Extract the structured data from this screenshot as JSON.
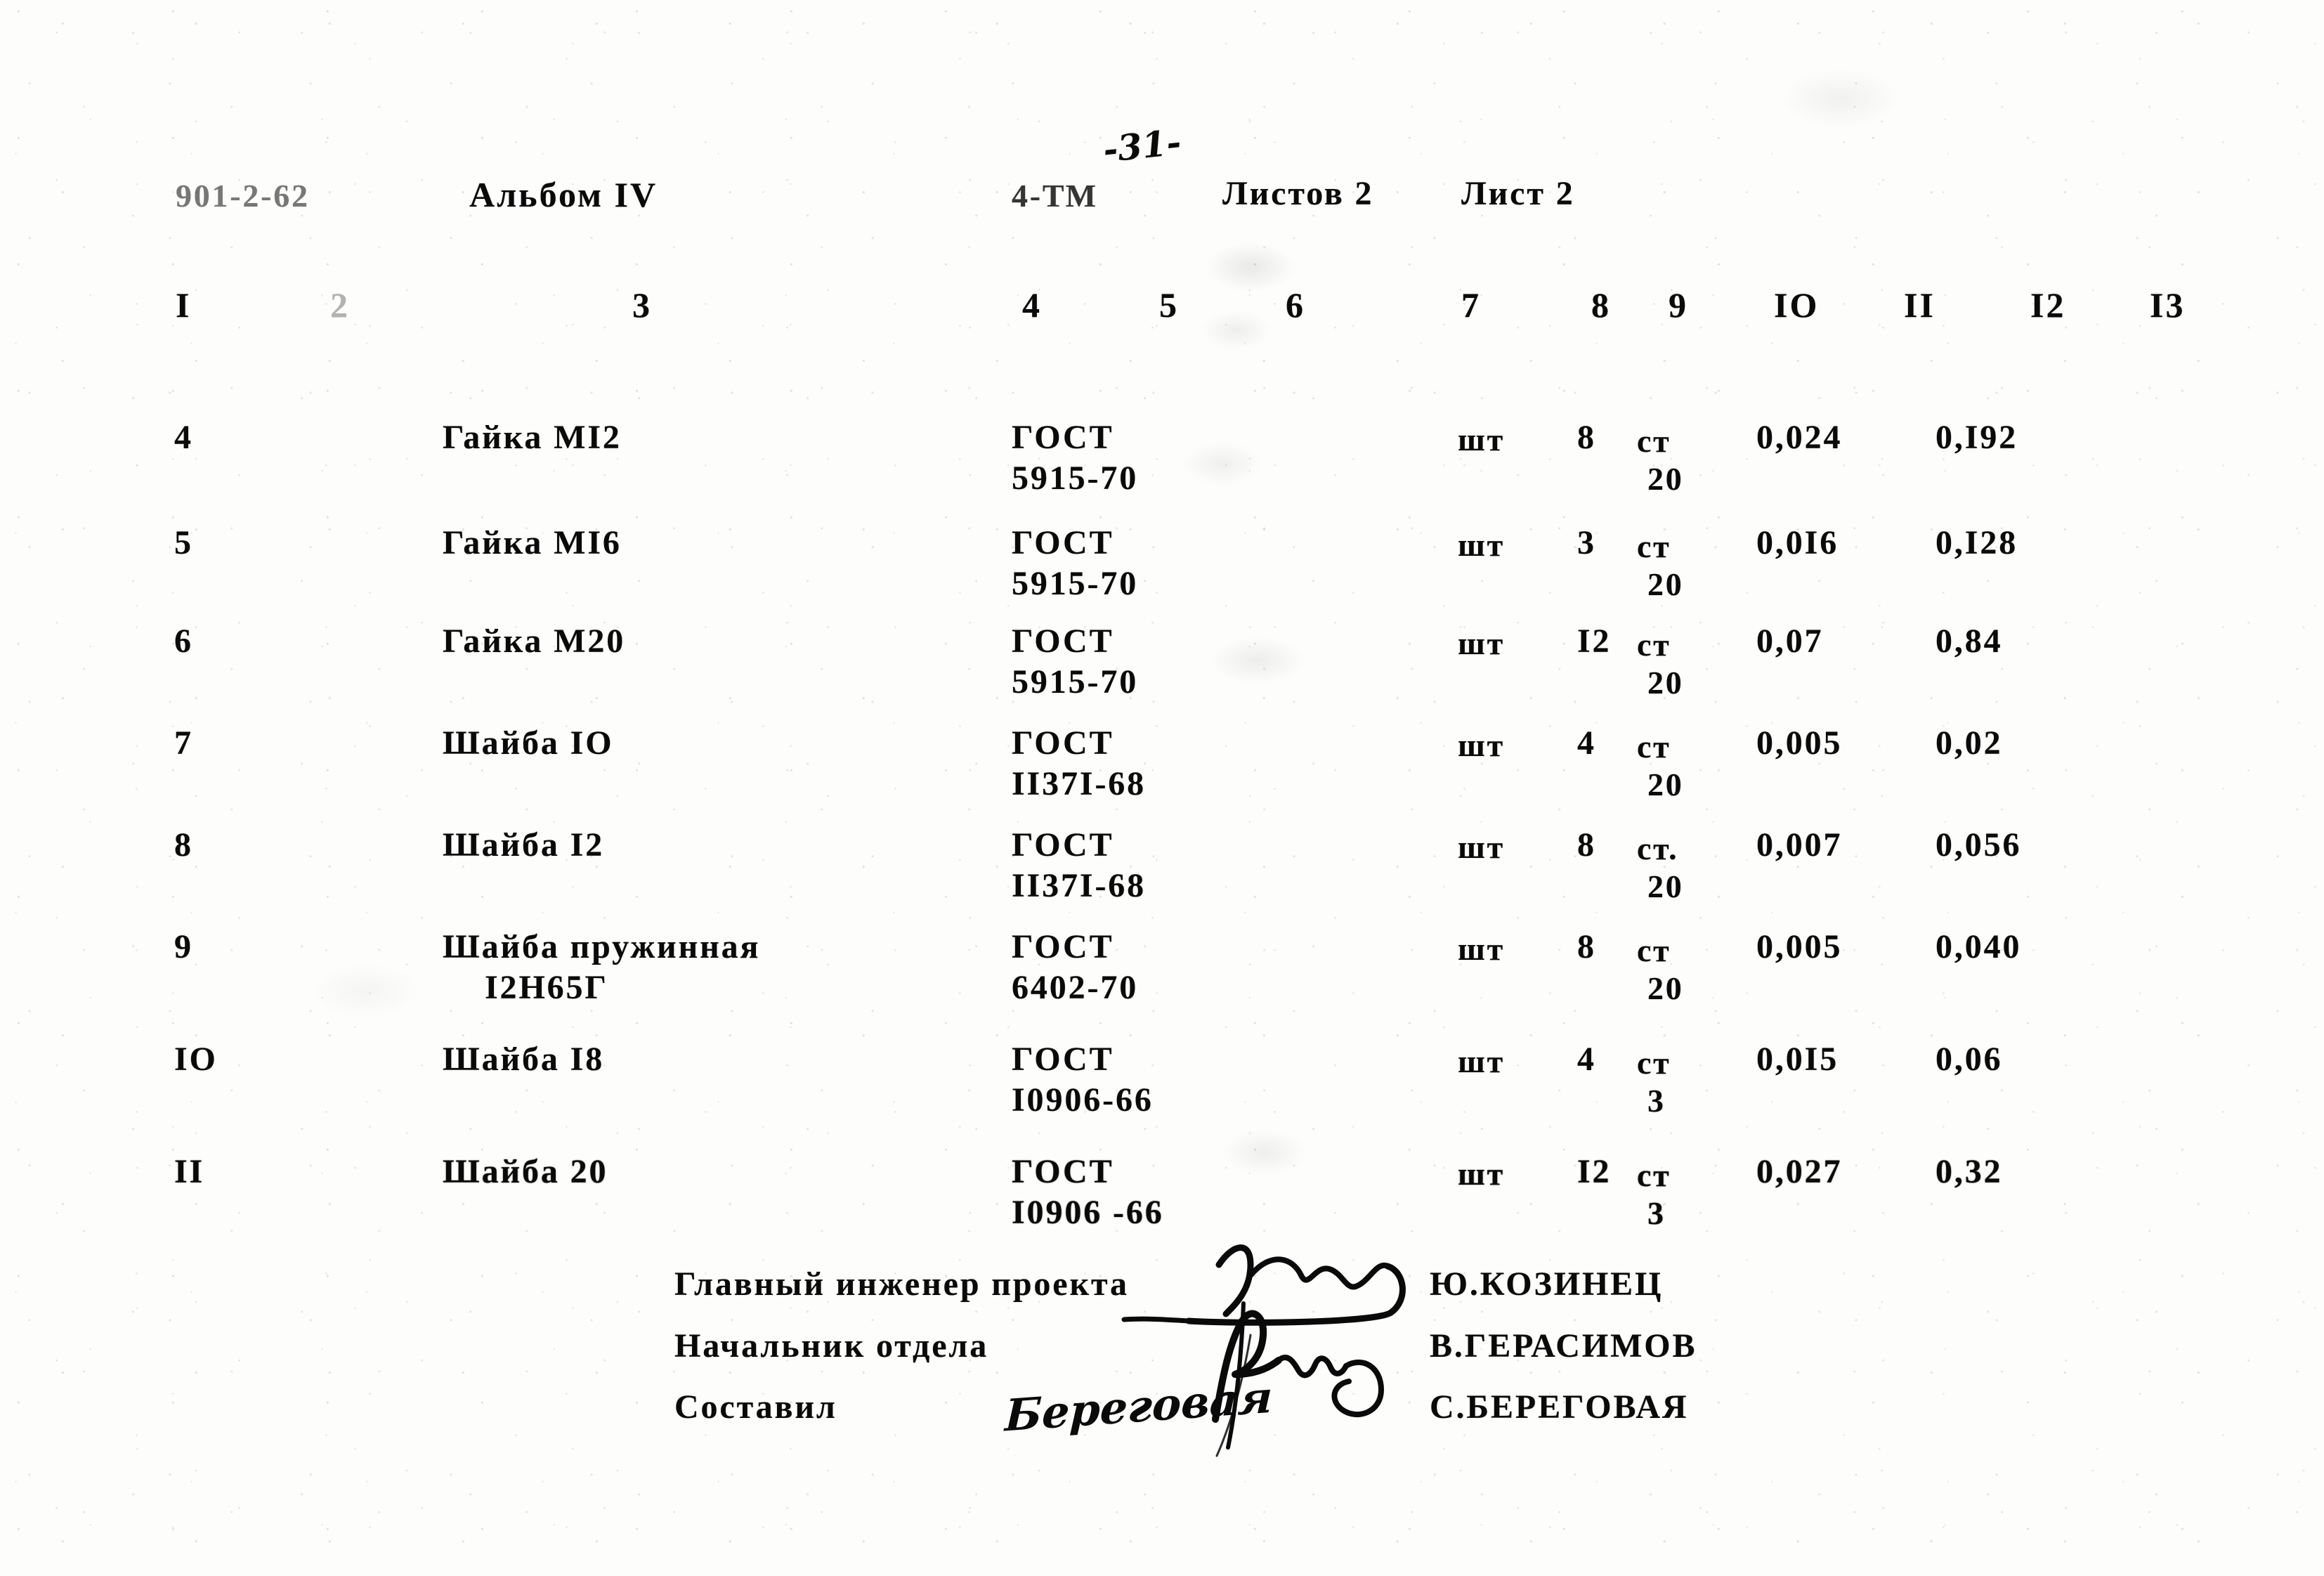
{
  "header": {
    "doc_code": "901-2-62",
    "album": "Альбом IV",
    "page_number": "-31-",
    "section": "4-ТМ",
    "sheets_total": "Листов 2",
    "sheet": "Лист 2"
  },
  "column_numbers": [
    "I",
    "2",
    "3",
    "4",
    "5",
    "6",
    "7",
    "8",
    "9",
    "IO",
    "II",
    "I2",
    "I3"
  ],
  "table": {
    "rows": [
      {
        "idx": "4",
        "name": "Гайка МI2",
        "name2": "",
        "standard": "ГОСТ",
        "standard_no": "5915-70",
        "unit": "шт",
        "qty": "8",
        "material": "ст",
        "material_grade": "20",
        "unit_weight": "0,024",
        "total_weight": "0,I92"
      },
      {
        "idx": "5",
        "name": "Гайка МI6",
        "name2": "",
        "standard": "ГОСТ",
        "standard_no": "5915-70",
        "unit": "шт",
        "qty": "3",
        "material": "ст",
        "material_grade": "20",
        "unit_weight": "0,0I6",
        "total_weight": "0,I28"
      },
      {
        "idx": "6",
        "name": "Гайка М20",
        "name2": "",
        "standard": "ГОСТ",
        "standard_no": "5915-70",
        "unit": "шт",
        "qty": "I2",
        "material": "ст",
        "material_grade": "20",
        "unit_weight": "0,07",
        "total_weight": "0,84"
      },
      {
        "idx": "7",
        "name": "Шайба IO",
        "name2": "",
        "standard": "ГОСТ",
        "standard_no": "II37I-68",
        "unit": "шт",
        "qty": "4",
        "material": "ст",
        "material_grade": "20",
        "unit_weight": "0,005",
        "total_weight": "0,02"
      },
      {
        "idx": "8",
        "name": "Шайба I2",
        "name2": "",
        "standard": "ГОСТ",
        "standard_no": "II37I-68",
        "unit": "шт",
        "qty": "8",
        "material": "ст.",
        "material_grade": "20",
        "unit_weight": "0,007",
        "total_weight": "0,056"
      },
      {
        "idx": "9",
        "name": "Шайба пружинная",
        "name2": "I2Н65Г",
        "standard": "ГОСТ",
        "standard_no": "6402-70",
        "unit": "шт",
        "qty": "8",
        "material": "ст",
        "material_grade": "20",
        "unit_weight": "0,005",
        "total_weight": "0,040"
      },
      {
        "idx": "IO",
        "name": "Шайба I8",
        "name2": "",
        "standard": "ГОСТ",
        "standard_no": "I0906-66",
        "unit": "шт",
        "qty": "4",
        "material": "ст",
        "material_grade": "3",
        "unit_weight": "0,0I5",
        "total_weight": "0,06"
      },
      {
        "idx": "II",
        "name": "Шайба 20",
        "name2": "",
        "standard": "ГОСТ",
        "standard_no": "I0906 -66",
        "unit": "шт",
        "qty": "I2",
        "material": "ст",
        "material_grade": "3",
        "unit_weight": "0,027",
        "total_weight": "0,32"
      }
    ]
  },
  "signatures": [
    {
      "role": "Главный инженер проекта",
      "name": "Ю.КОЗИНЕЦ",
      "mark": "Коз"
    },
    {
      "role": "Начальник отдела",
      "name": "В.ГЕРАСИМОВ",
      "mark": "Герас"
    },
    {
      "role": "Составил",
      "name": "С.БЕРЕГОВАЯ",
      "mark": "Береговая"
    }
  ]
}
